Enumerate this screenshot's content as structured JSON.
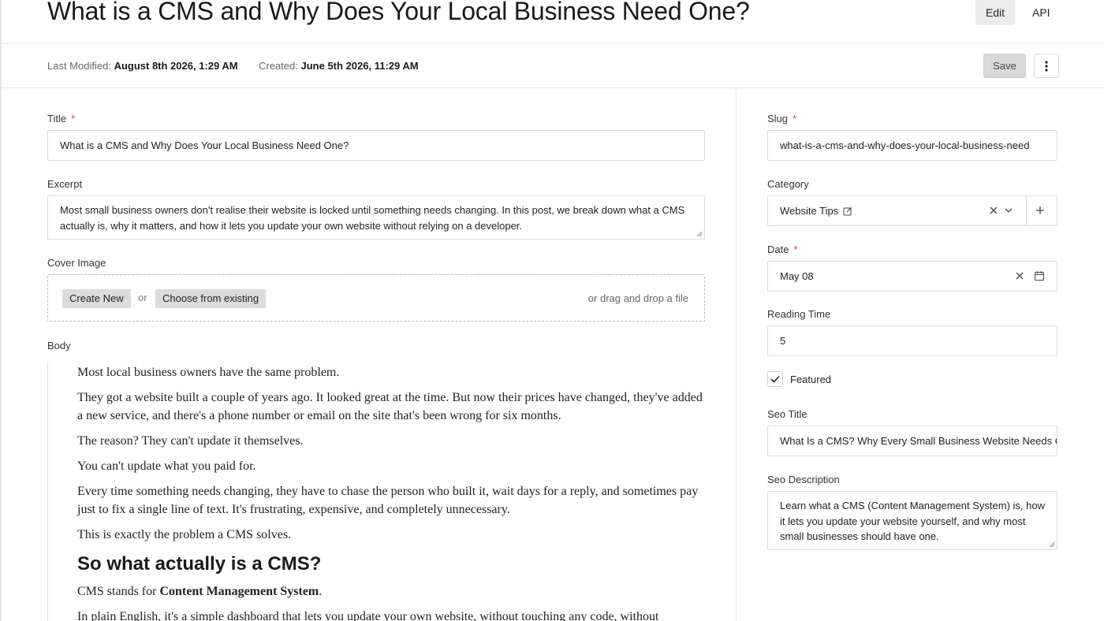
{
  "header": {
    "title": "What is a CMS and Why Does Your Local Business Need One?",
    "tabs": [
      {
        "label": "Edit",
        "active": true
      },
      {
        "label": "API",
        "active": false
      }
    ]
  },
  "meta": {
    "modified_label": "Last Modified:",
    "modified_value": "August 8th 2026, 1:29 AM",
    "created_label": "Created:",
    "created_value": "June 5th 2026, 11:29 AM",
    "save_label": "Save"
  },
  "fields": {
    "title": {
      "label": "Title",
      "required": "*",
      "value": "What is a CMS and Why Does Your Local Business Need One?"
    },
    "excerpt": {
      "label": "Excerpt",
      "value": "Most small business owners don't realise their website is locked until something needs changing. In this post, we break down what a CMS actually is, why it matters, and how it lets you update your own website without relying on a developer."
    },
    "cover": {
      "label": "Cover Image",
      "create_label": "Create New",
      "or_text": "or",
      "choose_label": "Choose from existing",
      "drop_text": "or drag and drop a file"
    },
    "body": {
      "label": "Body",
      "p1": "Most local business owners have the same problem.",
      "p2": "They got a website built a couple of years ago. It looked great at the time. But now their prices have changed, they've added a new service, and there's a phone number or email on the site that's been wrong for six months.",
      "p3": "The reason? They can't update it themselves.",
      "p4": "You can't update what you paid for.",
      "p5": "Every time something needs changing, they have to chase the person who built it, wait days for a reply, and sometimes pay just to fix a single line of text. It's frustrating, expensive, and completely unnecessary.",
      "p6": "This is exactly the problem a CMS solves.",
      "h2": "So what actually is a CMS?",
      "p7_pre": "CMS stands for ",
      "p7_bold": "Content Management System",
      "p7_post": ".",
      "p8": "In plain English, it's a simple dashboard that lets you update your own website, without touching any code, without"
    },
    "slug": {
      "label": "Slug",
      "required": "*",
      "value": "what-is-a-cms-and-why-does-your-local-business-need"
    },
    "category": {
      "label": "Category",
      "value": "Website Tips"
    },
    "date": {
      "label": "Date",
      "required": "*",
      "value": "May 08"
    },
    "reading_time": {
      "label": "Reading Time",
      "value": "5"
    },
    "featured": {
      "label": "Featured",
      "checked": true
    },
    "seo_title": {
      "label": "Seo Title",
      "value": "What Is a CMS? Why Every Small Business Website Needs One"
    },
    "seo_description": {
      "label": "Seo Description",
      "value": "Learn what a CMS (Content Management System) is, how it lets you update your website yourself, and why most small businesses should have one."
    }
  },
  "icons": {
    "more": "vertical-dots-icon",
    "edit": "pencil-square-icon",
    "clear": "close-icon",
    "chevron": "chevron-down-icon",
    "add": "plus-icon",
    "calendar": "calendar-icon",
    "check": "check-icon"
  },
  "colors": {
    "required": "#dd3333",
    "active_tab": "#ececec",
    "save_bg": "#d9d9d9"
  }
}
